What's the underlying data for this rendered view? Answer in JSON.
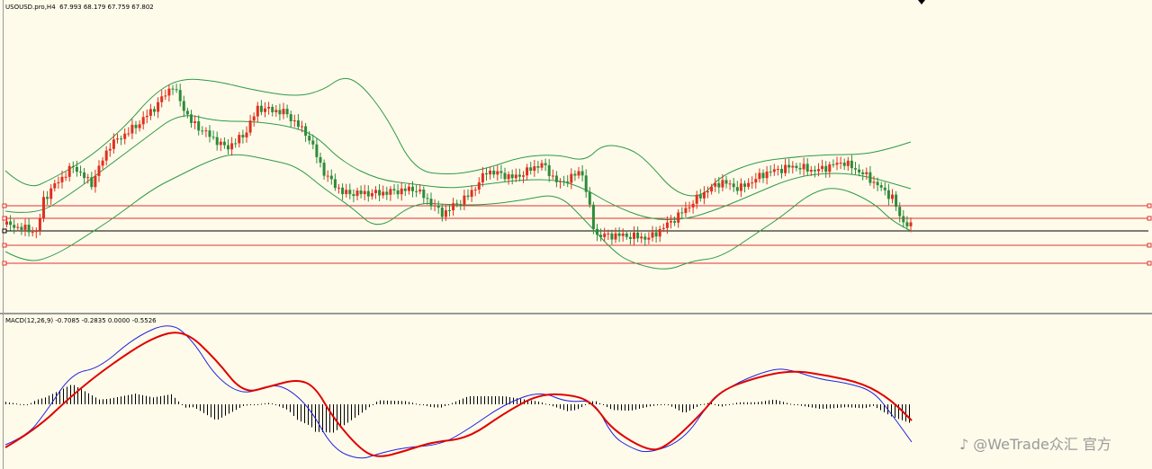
{
  "chart_window": {
    "price_header": "USOUSD.pro,H4  67.993 68.179 67.759 67.802",
    "macd_header": "MACD(12,26,9) -0.7085 -0.2835 0.0000 -0.5526",
    "watermark": "♪ @WeTrade众汇 官方"
  },
  "colors": {
    "background": "#fefbea",
    "bull": "#e0301e",
    "bear": "#2e8b3a",
    "bands": "#2f9a48",
    "levels": "#e03030",
    "macd_line": "#2020e0",
    "signal_line": "#e00000",
    "current_price_line": "#000000"
  },
  "chart_data": [
    {
      "type": "candlestick",
      "series": [
        {
          "name": "USOUSD.pro,H4",
          "ohlc_last": {
            "open": 67.993,
            "high": 68.179,
            "low": 67.759,
            "close": 67.802
          }
        }
      ],
      "overlays": [
        "Bollinger Bands",
        "horizontal levels"
      ],
      "grid": false
    },
    {
      "type": "line",
      "series": [
        {
          "name": "MACD(12,26,9)",
          "values": [
            -0.7085,
            -0.2835,
            0.0,
            -0.5526
          ]
        }
      ],
      "grid": false
    }
  ]
}
